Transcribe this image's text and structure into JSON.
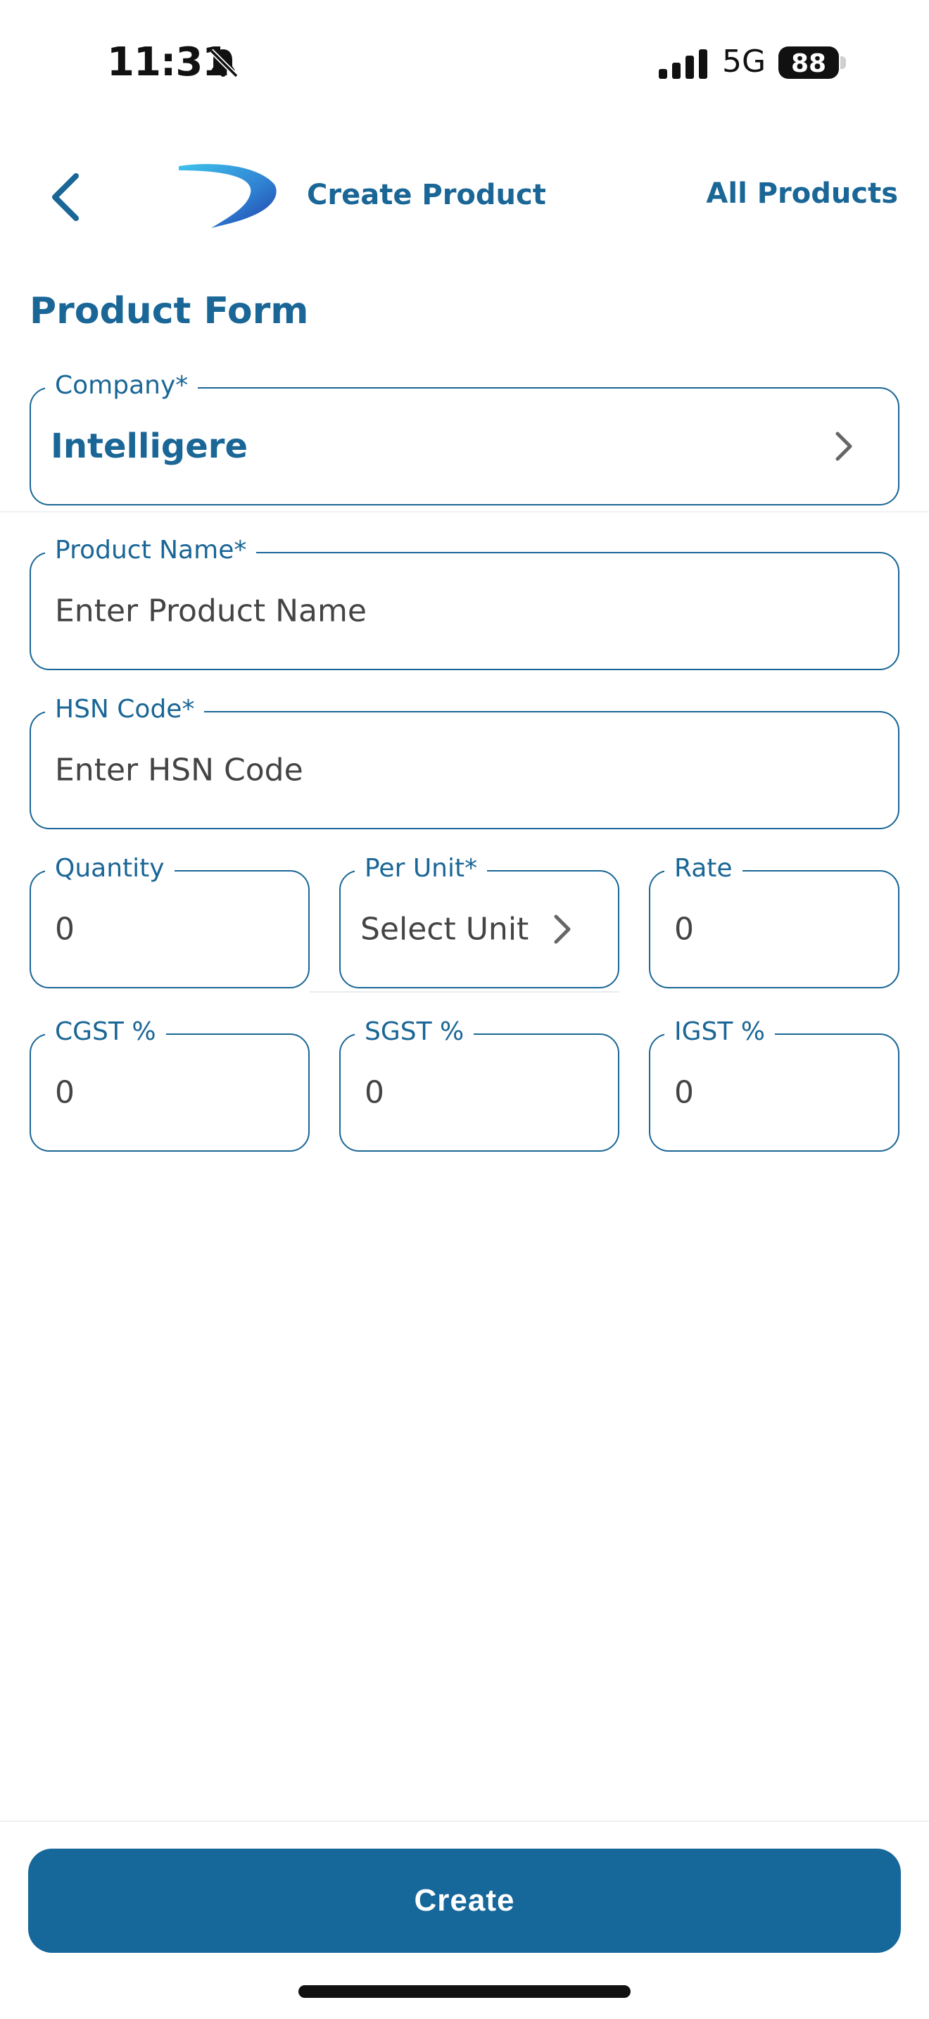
{
  "status_bar": {
    "time": "11:31",
    "network": "5G",
    "battery": "88"
  },
  "header": {
    "title": "Create Product",
    "all_products_label": "All Products"
  },
  "form": {
    "title": "Product Form",
    "company": {
      "label": "Company*",
      "value": "Intelligere"
    },
    "product_name": {
      "label": "Product Name*",
      "placeholder": "Enter Product Name"
    },
    "hsn_code": {
      "label": "HSN Code*",
      "placeholder": "Enter HSN Code"
    },
    "quantity": {
      "label": "Quantity",
      "value": "0"
    },
    "per_unit": {
      "label": "Per Unit*",
      "value": "Select Unit"
    },
    "rate": {
      "label": "Rate",
      "value": "0"
    },
    "cgst": {
      "label": "CGST %",
      "value": "0"
    },
    "sgst": {
      "label": "SGST %",
      "value": "0"
    },
    "igst": {
      "label": "IGST %",
      "value": "0"
    }
  },
  "footer": {
    "create_label": "Create"
  },
  "colors": {
    "primary": "#1a6696",
    "button": "#16679a"
  }
}
